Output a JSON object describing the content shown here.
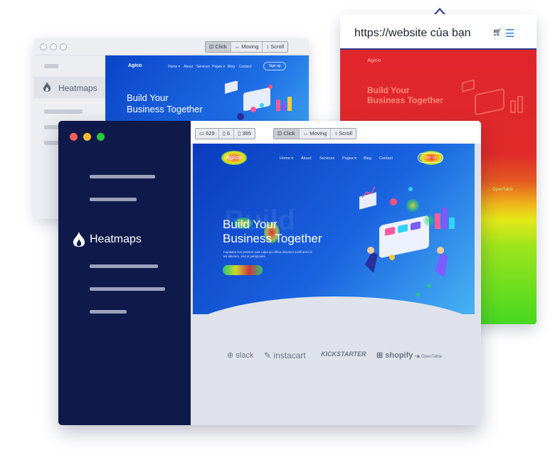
{
  "back_window": {
    "sidebar_label": "Heatmaps",
    "controls": [
      "Click",
      "Moving",
      "Scroll"
    ],
    "site": {
      "logo": "Agico",
      "nav": [
        "Home ▾",
        "About",
        "Services",
        "Pages ▾",
        "Blog",
        "Contact"
      ],
      "signup": "Sign up",
      "headline_1": "Build Your",
      "headline_2": "Business Together"
    }
  },
  "right_window": {
    "url": "https://website của bạn",
    "cart_icon": "cart-icon",
    "menu_icon": "hamburger-icon",
    "site": {
      "logo": "Agico",
      "headline_1": "Build Your",
      "headline_2": "Business Together",
      "partner": "OpenTable"
    }
  },
  "front_window": {
    "sidebar_label": "Heatmaps",
    "stats": [
      {
        "icon": "monitor-icon",
        "value": "629"
      },
      {
        "icon": "tablet-icon",
        "value": "6"
      },
      {
        "icon": "phone-icon",
        "value": "365"
      }
    ],
    "controls": [
      "Click",
      "Moving",
      "Scroll"
    ],
    "site": {
      "logo": "Agico",
      "nav": [
        "Home ▾",
        "About",
        "Services",
        "Pages ▾",
        "Blog",
        "Contact"
      ],
      "signup": "Sign up",
      "ghost": "Build",
      "headline_1": "Build Your",
      "headline_2": "Business Together",
      "subtext": "Cupidatat non proident sunt culpa qui officia deserunt mollit anim id est laborum. Sed ut perspiciatis.",
      "partners": [
        "slack",
        "instacart",
        "KICKSTARTER",
        "shopify",
        "OpenTable"
      ]
    }
  },
  "colors": {
    "sidebar_dark": "#0f1a4a",
    "hero_blue": "#1a63e0",
    "heat_red": "#e0262d",
    "heat_green": "#45d81f",
    "traffic_red": "#ff5f57",
    "traffic_yellow": "#febc2e",
    "traffic_green": "#28c840"
  }
}
